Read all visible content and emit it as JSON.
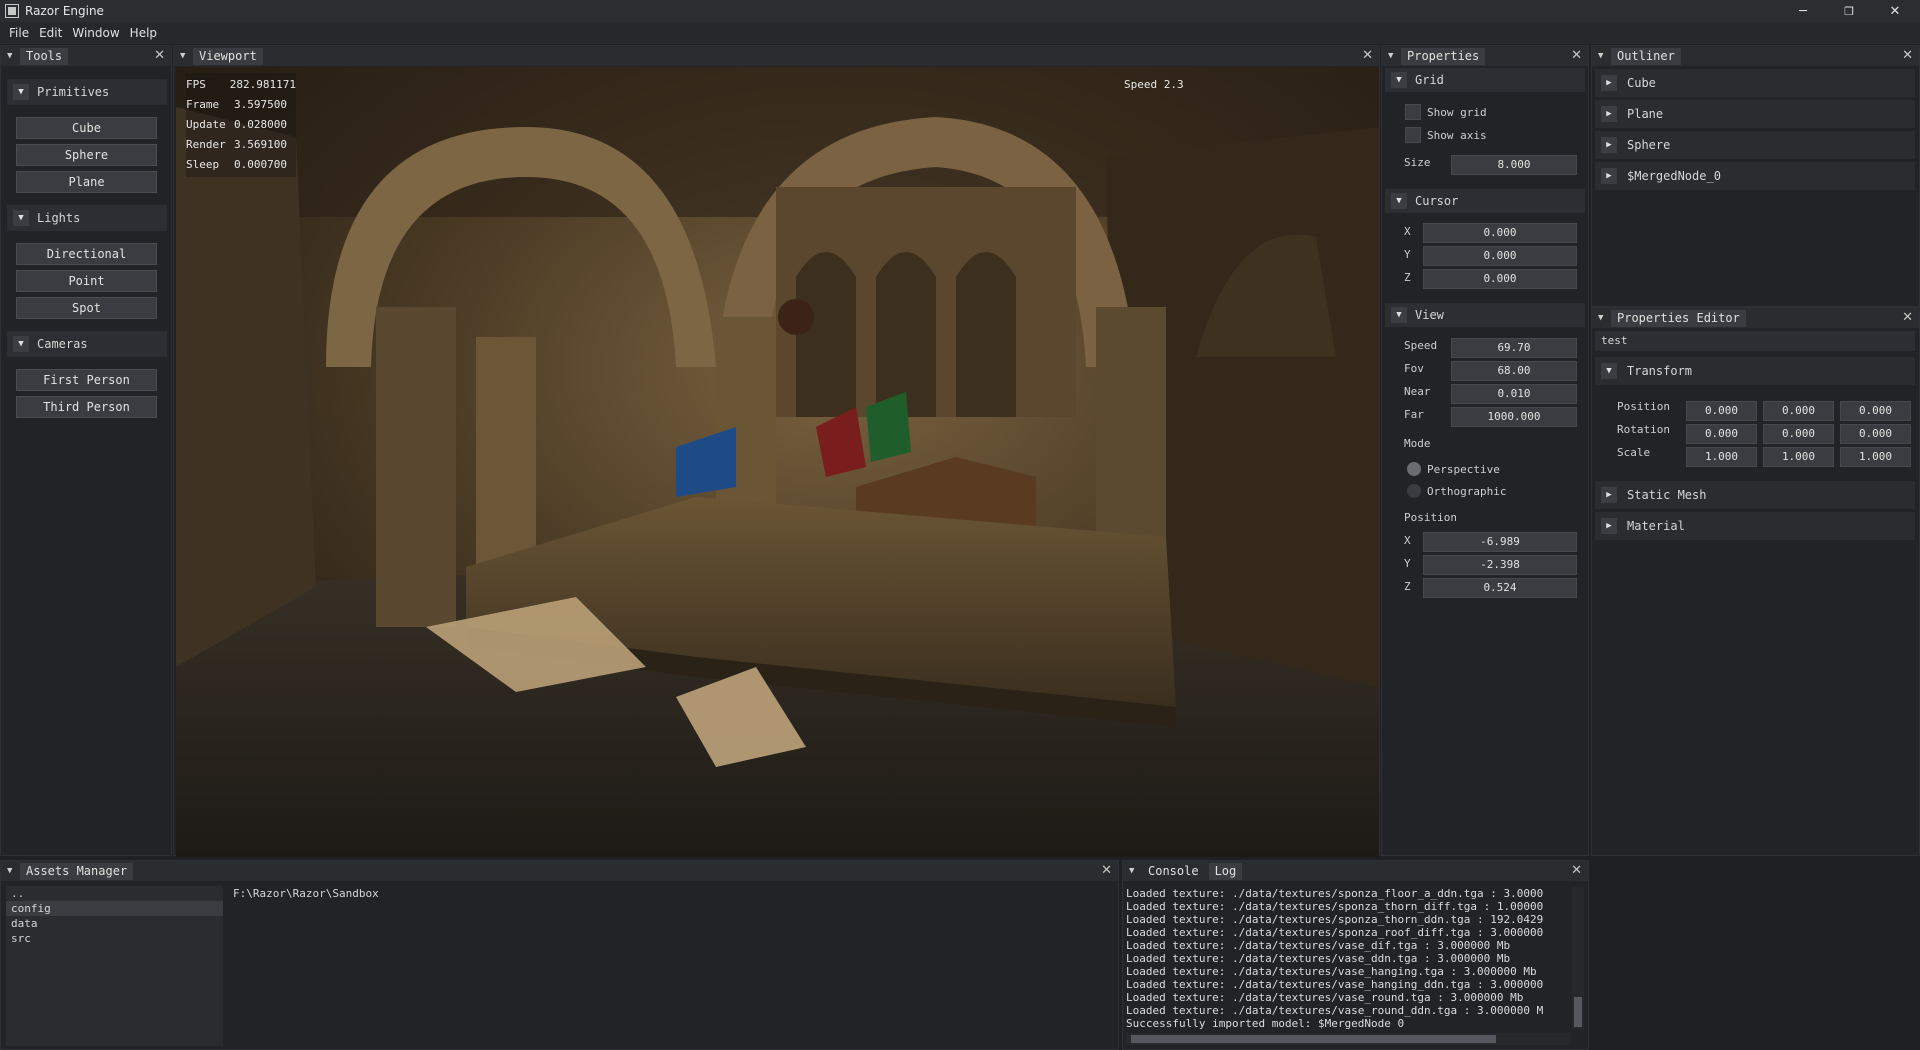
{
  "window": {
    "title": "Razor Engine",
    "minimize": "─",
    "restore": "❐",
    "close": "✕"
  },
  "menu": [
    "File",
    "Edit",
    "Window",
    "Help"
  ],
  "tools": {
    "tab": "Tools",
    "primitives": {
      "label": "Primitives",
      "items": [
        "Cube",
        "Sphere",
        "Plane"
      ]
    },
    "lights": {
      "label": "Lights",
      "items": [
        "Directional",
        "Point",
        "Spot"
      ]
    },
    "cameras": {
      "label": "Cameras",
      "items": [
        "First Person",
        "Third Person"
      ]
    }
  },
  "viewport": {
    "tab": "Viewport",
    "stats": [
      {
        "label": "FPS",
        "value": "282.981171"
      },
      {
        "label": "Frame",
        "value": "3.597500"
      },
      {
        "label": "Update",
        "value": "0.028000"
      },
      {
        "label": "Render",
        "value": "3.569100"
      },
      {
        "label": "Sleep",
        "value": "0.000700"
      }
    ],
    "speed": "Speed 2.3"
  },
  "properties": {
    "tab": "Properties",
    "grid": {
      "label": "Grid",
      "show_grid": "Show grid",
      "show_axis": "Show axis",
      "size_label": "Size",
      "size": "8.000"
    },
    "cursor": {
      "label": "Cursor",
      "x": "0.000",
      "y": "0.000",
      "z": "0.000"
    },
    "view": {
      "label": "View",
      "speed_label": "Speed",
      "speed": "69.70",
      "fov_label": "Fov",
      "fov": "68.00",
      "near_label": "Near",
      "near": "0.010",
      "far_label": "Far",
      "far": "1000.000",
      "mode_label": "Mode",
      "perspective": "Perspective",
      "orthographic": "Orthographic",
      "selected_mode": "Perspective",
      "position_label": "Position",
      "pos_x": "-6.989",
      "pos_y": "-2.398",
      "pos_z": "0.524"
    },
    "axis_x": "X",
    "axis_y": "Y",
    "axis_z": "Z"
  },
  "outliner": {
    "tab": "Outliner",
    "items": [
      "Cube",
      "Plane",
      "Sphere",
      "$MergedNode_0"
    ]
  },
  "properties_editor": {
    "tab": "Properties Editor",
    "name": "test",
    "transform": {
      "label": "Transform",
      "position_label": "Position",
      "position": [
        "0.000",
        "0.000",
        "0.000"
      ],
      "rotation_label": "Rotation",
      "rotation": [
        "0.000",
        "0.000",
        "0.000"
      ],
      "scale_label": "Scale",
      "scale": [
        "1.000",
        "1.000",
        "1.000"
      ]
    },
    "static_mesh": "Static Mesh",
    "material": "Material"
  },
  "assets": {
    "tab": "Assets Manager",
    "folders": [
      "..",
      "config",
      "data",
      "src"
    ],
    "selected": "config",
    "path": "F:\\Razor\\Razor\\Sandbox"
  },
  "console": {
    "tabs": [
      "Console",
      "Log"
    ],
    "lines": [
      "Loaded texture: ./data/textures/sponza_floor_a_ddn.tga : 3.0000",
      "Loaded texture: ./data/textures/sponza_thorn_diff.tga : 1.00000",
      "Loaded texture: ./data/textures/sponza_thorn_ddn.tga : 192.0429",
      "Loaded texture: ./data/textures/sponza_roof_diff.tga : 3.000000",
      "Loaded texture: ./data/textures/vase_dif.tga : 3.000000 Mb",
      "Loaded texture: ./data/textures/vase_ddn.tga : 3.000000 Mb",
      "Loaded texture: ./data/textures/vase_hanging.tga : 3.000000 Mb",
      "Loaded texture: ./data/textures/vase_hanging_ddn.tga : 3.000000",
      "Loaded texture: ./data/textures/vase_round.tga : 3.000000 Mb",
      "Loaded texture: ./data/textures/vase_round_ddn.tga : 3.000000 M",
      "Successfully imported model: $MergedNode_0"
    ]
  },
  "colors": {
    "bg": "#1f2024",
    "panel": "#222327",
    "header": "#2a2c30",
    "button": "#3a3c41"
  }
}
